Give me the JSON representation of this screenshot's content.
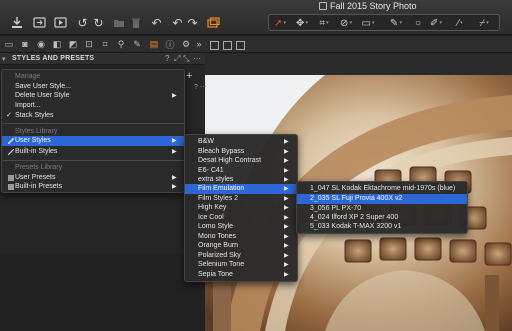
{
  "window": {
    "title": "Fall 2015 Story Photo"
  },
  "toolbar": {
    "icons": [
      "import-icon",
      "export-icon",
      "process-icon",
      "rotate-left-icon",
      "rotate-right-icon",
      "folder-icon",
      "trash-icon",
      "undo-icon",
      "undo-icon",
      "redo-icon",
      "layers-icon"
    ],
    "cursor_tools": [
      "pointer-icon",
      "crop-icon",
      "straighten-icon",
      "keystone-icon",
      "rotate-icon",
      "draw-mask-icon",
      "circle-icon",
      "brush-icon",
      "eyedropper-icon",
      "picker-icon"
    ]
  },
  "tabs": [
    "library-icon",
    "capture-icon",
    "lens-icon",
    "color-icon",
    "exposure-icon",
    "crop-tab-icon",
    "details-icon",
    "local-adjust-icon",
    "adjustments-icon",
    "metadata-icon",
    "settings-icon",
    "more-icon"
  ],
  "panel": {
    "title": "STYLES AND PRESETS"
  },
  "menu1": {
    "items": [
      {
        "label": "Manage",
        "type": "header"
      },
      {
        "label": "Save User Style..."
      },
      {
        "label": "Delete User Style",
        "arrow": true
      },
      {
        "label": "Import..."
      },
      {
        "label": "Stack Styles",
        "checked": true
      },
      {
        "label": "Styles Library",
        "type": "header"
      },
      {
        "label": "User Styles",
        "arrow": true,
        "highlighted": true
      },
      {
        "label": "Built-in Styles",
        "arrow": true
      },
      {
        "label": "Presets Library",
        "type": "header"
      },
      {
        "label": "User Presets",
        "arrow": true
      },
      {
        "label": "Built-in Presets",
        "arrow": true
      }
    ]
  },
  "menu2": {
    "items": [
      "B&W",
      "Bleach Bypass",
      "Desat High Contrast",
      "E6- C41",
      "extra styles",
      "Film Emulation",
      "Film Styles 2",
      "High Key",
      "Ice Cool",
      "Lomo Style",
      "Mono Tones",
      "Orange Burn",
      "Polarized Sky",
      "Selenium Tone",
      "Sepia Tone"
    ],
    "highlighted": "Film Emulation"
  },
  "menu3": {
    "items": [
      "1_047 SL Kodak Ektachrome mid-1970s (blue)",
      "2_035 SL Fuji Provia 400X v2",
      "3_056 PL PX-70",
      "4_024 Ilford XP 2 Super 400",
      "5_033 Kodak T-MAX 3200 v1"
    ],
    "highlighted": "2_035 SL Fuji Provia 400X v2"
  }
}
